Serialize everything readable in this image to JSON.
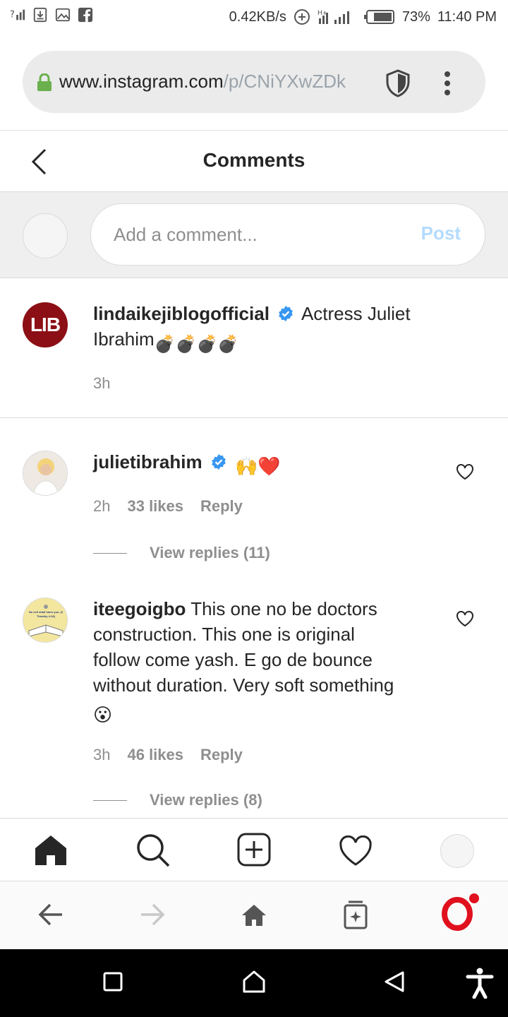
{
  "status_bar": {
    "speed": "0.42KB/s",
    "battery": "73%",
    "time": "11:40 PM"
  },
  "browser": {
    "url_host": "www.instagram.com",
    "url_path": "/p/CNiYXwZDk"
  },
  "header": {
    "title": "Comments"
  },
  "composer": {
    "placeholder": "Add a comment...",
    "post_label": "Post"
  },
  "caption": {
    "username": "lindaikejiblogofficial",
    "avatar_text": "LIB",
    "text_line1": "Actress Juliet",
    "text_line2": "Ibrahim",
    "emojis": "💣💣💣💣",
    "time": "3h"
  },
  "comments": [
    {
      "username": "julietibrahim",
      "text": "🙌❤️",
      "time": "2h",
      "likes": "33 likes",
      "reply_label": "Reply",
      "view_replies": "View replies (11)"
    },
    {
      "username": "iteegoigbo",
      "avatar_text": "No evil shall harm you. (2 Timothy 4:18)",
      "text_line1": "This one no be doctors",
      "text_line2": "construction. This one is original",
      "text_line3": "follow come yash. E go de bounce",
      "text_line4": "without duration. Very soft something",
      "text_line5": "😮",
      "time": "3h",
      "likes": "46 likes",
      "reply_label": "Reply",
      "view_replies": "View replies (8)"
    }
  ],
  "colors": {
    "accent_blue": "#0095f6",
    "post_disabled": "#b3dbff",
    "verified": "#3897f0",
    "opera_red": "#e0101e"
  }
}
